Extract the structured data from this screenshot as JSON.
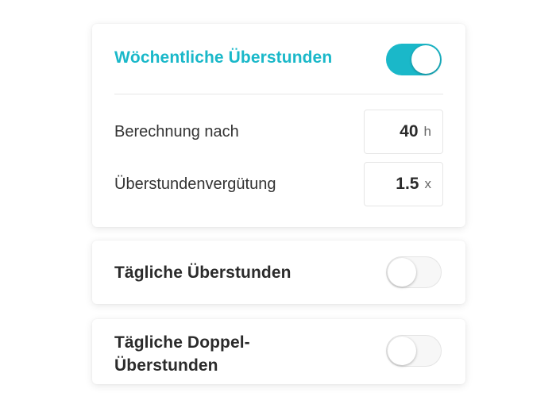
{
  "weekly": {
    "title": "Wöchentliche Überstunden",
    "enabled": true,
    "calc_label": "Berechnung nach",
    "calc_value": "40",
    "calc_unit": "h",
    "rate_label": "Überstundenvergütung",
    "rate_value": "1.5",
    "rate_unit": "x"
  },
  "daily": {
    "title": "Tägliche Überstunden",
    "enabled": false
  },
  "double": {
    "title_line1": "Tägliche Doppel-",
    "title_line2": "Überstunden",
    "enabled": false
  },
  "colors": {
    "accent": "#1ab8c9",
    "text": "#2b2b2b",
    "toggle_off_bg": "#f7f7f7"
  }
}
